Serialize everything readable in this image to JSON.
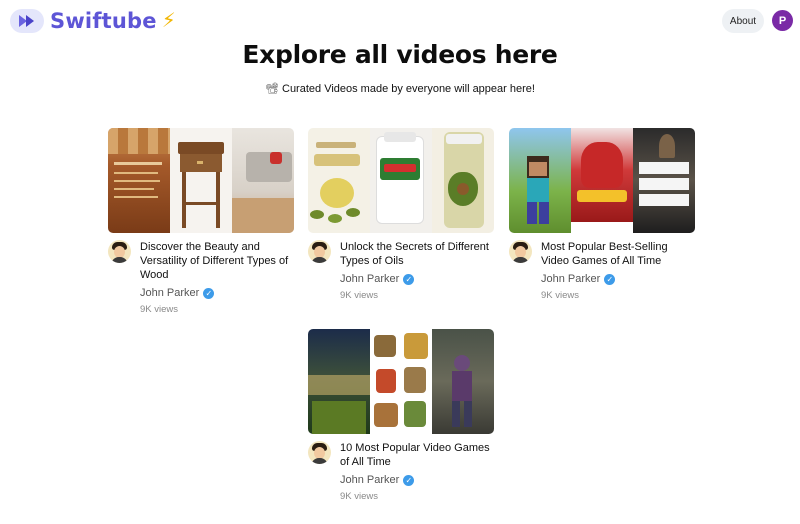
{
  "header": {
    "brand": "Swiftube",
    "about_label": "About",
    "avatar_initial": "P"
  },
  "page": {
    "title": "Explore all videos here",
    "subtitle": "Curated Videos made by everyone will appear here!"
  },
  "icons": {
    "logo": "play-forward-icon",
    "bolt": "lightning-bolt-icon",
    "subtitle": "video-camera-icon",
    "verified": "verified-badge-icon"
  },
  "colors": {
    "brand": "#5d55d6",
    "avatar": "#7a2aa6",
    "verified": "#3d9be9"
  },
  "videos": [
    {
      "title": "Discover the Beauty and Versatility of Different Types of Wood",
      "channel": "John Parker",
      "views": "9K views"
    },
    {
      "title": "Unlock the Secrets of Different Types of Oils",
      "channel": "John Parker",
      "views": "9K views"
    },
    {
      "title": "Most Popular Best-Selling Video Games of All Time",
      "channel": "John Parker",
      "views": "9K views"
    },
    {
      "title": "10 Most Popular Video Games of All Time",
      "channel": "John Parker",
      "views": "9K views"
    }
  ]
}
